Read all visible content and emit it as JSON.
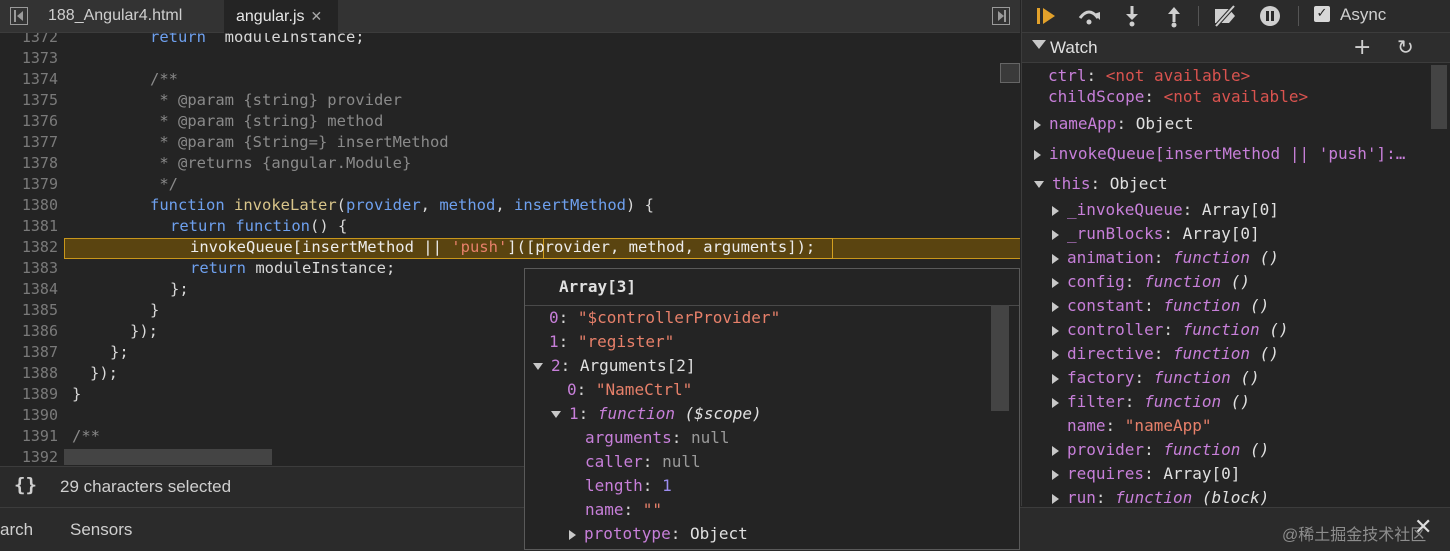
{
  "tabs": [
    {
      "label": "188_Angular4.html"
    },
    {
      "label": "angular.js",
      "close": "✕"
    }
  ],
  "code": [
    {
      "ln": "1372"
    },
    {
      "ln": "1373"
    },
    {
      "ln": "1374"
    },
    {
      "ln": "1375"
    },
    {
      "ln": "1376"
    },
    {
      "ln": "1377"
    },
    {
      "ln": "1378"
    },
    {
      "ln": "1379"
    },
    {
      "ln": "1380"
    },
    {
      "ln": "1381"
    },
    {
      "ln": "1382"
    },
    {
      "ln": "1383"
    },
    {
      "ln": "1384"
    },
    {
      "ln": "1385"
    },
    {
      "ln": "1386"
    },
    {
      "ln": "1387"
    },
    {
      "ln": "1388"
    },
    {
      "ln": "1389"
    },
    {
      "ln": "1390"
    },
    {
      "ln": "1391"
    },
    {
      "ln": "1392"
    }
  ],
  "code_text": {
    "l1372": {
      "kw": "return",
      "rest": "  moduleInstance;"
    },
    "l1374": "/**",
    "l1375": " * @param {string} provider",
    "l1376": " * @param {string} method",
    "l1377": " * @param {String=} insertMethod",
    "l1378": " * @returns {angular.Module}",
    "l1379": " */",
    "l1380": {
      "kw": "function",
      "name": "invokeLater",
      "open": "(",
      "p1": "provider",
      "c1": ", ",
      "p2": "method",
      "c2": ", ",
      "p3": "insertMethod",
      "close": ") {"
    },
    "l1381": {
      "kw1": "return",
      "kw2": "function",
      "rest": "() {"
    },
    "l1382": {
      "a": "invokeQueue[insertMethod || ",
      "str": "'push'",
      "b": "](",
      "sel": "[provider, method, arguments]",
      "c": ");"
    },
    "l1383": {
      "kw": "return",
      "rest": " moduleInstance;"
    },
    "l1384": "};",
    "l1385": "}",
    "l1386": "});",
    "l1387": "};",
    "l1388": "});",
    "l1389": "}",
    "l1391": "/**"
  },
  "status": {
    "braces": "{}",
    "selection": "29 characters selected"
  },
  "drawer": {
    "search": "arch",
    "sensors": "Sensors",
    "close": "✕",
    "watermark": "@稀土掘金技术社区"
  },
  "toolbar": {
    "async_label": "Async",
    "async_checked": "✓"
  },
  "watch": {
    "title": "Watch",
    "add": "+",
    "refresh": "↻",
    "ctrl": {
      "key": "ctrl",
      "val": "<not available>"
    },
    "childScope": {
      "key": "childScope",
      "val": "<not available>"
    },
    "nameApp": {
      "key": "nameApp",
      "val": "Object"
    },
    "invoke": {
      "key": "invokeQueue[insertMethod || 'push']:…"
    },
    "this": {
      "key": "this",
      "val": "Object"
    },
    "props": [
      {
        "key": "_invokeQueue",
        "val": "Array[0]",
        "kind": "plain"
      },
      {
        "key": "_runBlocks",
        "val": "Array[0]",
        "kind": "plain"
      },
      {
        "key": "animation",
        "val": "function",
        "par": "()",
        "kind": "fn"
      },
      {
        "key": "config",
        "val": "function",
        "par": "()",
        "kind": "fn"
      },
      {
        "key": "constant",
        "val": "function",
        "par": "()",
        "kind": "fn"
      },
      {
        "key": "controller",
        "val": "function",
        "par": "()",
        "kind": "fn"
      },
      {
        "key": "directive",
        "val": "function",
        "par": "()",
        "kind": "fn"
      },
      {
        "key": "factory",
        "val": "function",
        "par": "()",
        "kind": "fn"
      },
      {
        "key": "filter",
        "val": "function",
        "par": "()",
        "kind": "fn"
      },
      {
        "key": "name",
        "val": "\"nameApp\"",
        "kind": "str"
      },
      {
        "key": "provider",
        "val": "function",
        "par": "()",
        "kind": "fn"
      },
      {
        "key": "requires",
        "val": "Array[0]",
        "kind": "plain"
      },
      {
        "key": "run",
        "val": "function",
        "par": "(block)",
        "kind": "fn"
      }
    ]
  },
  "popover": {
    "title": "Array[3]",
    "rows": {
      "r0": {
        "key": "0",
        "val": "\"$controllerProvider\""
      },
      "r1": {
        "key": "1",
        "val": "\"register\""
      },
      "r2": {
        "key": "2",
        "val": "Arguments[2]"
      },
      "r3": {
        "key": "0",
        "val": "\"NameCtrl\""
      },
      "r4": {
        "key": "1",
        "val": "function",
        "par": "($scope)"
      },
      "r5": {
        "key": "arguments",
        "val": "null"
      },
      "r6": {
        "key": "caller",
        "val": "null"
      },
      "r7": {
        "key": "length",
        "val": "1"
      },
      "r8": {
        "key": "name",
        "val": "\"\""
      },
      "r9": {
        "key": "prototype",
        "val": "Object"
      }
    }
  },
  "colors": {
    "highlight_bg": "#5a4410",
    "highlight_border": "#c8961b",
    "keyword": "#6ea0ee",
    "string": "#e7806a",
    "property": "#c77fd9",
    "step_icon": "#e2a12b"
  }
}
